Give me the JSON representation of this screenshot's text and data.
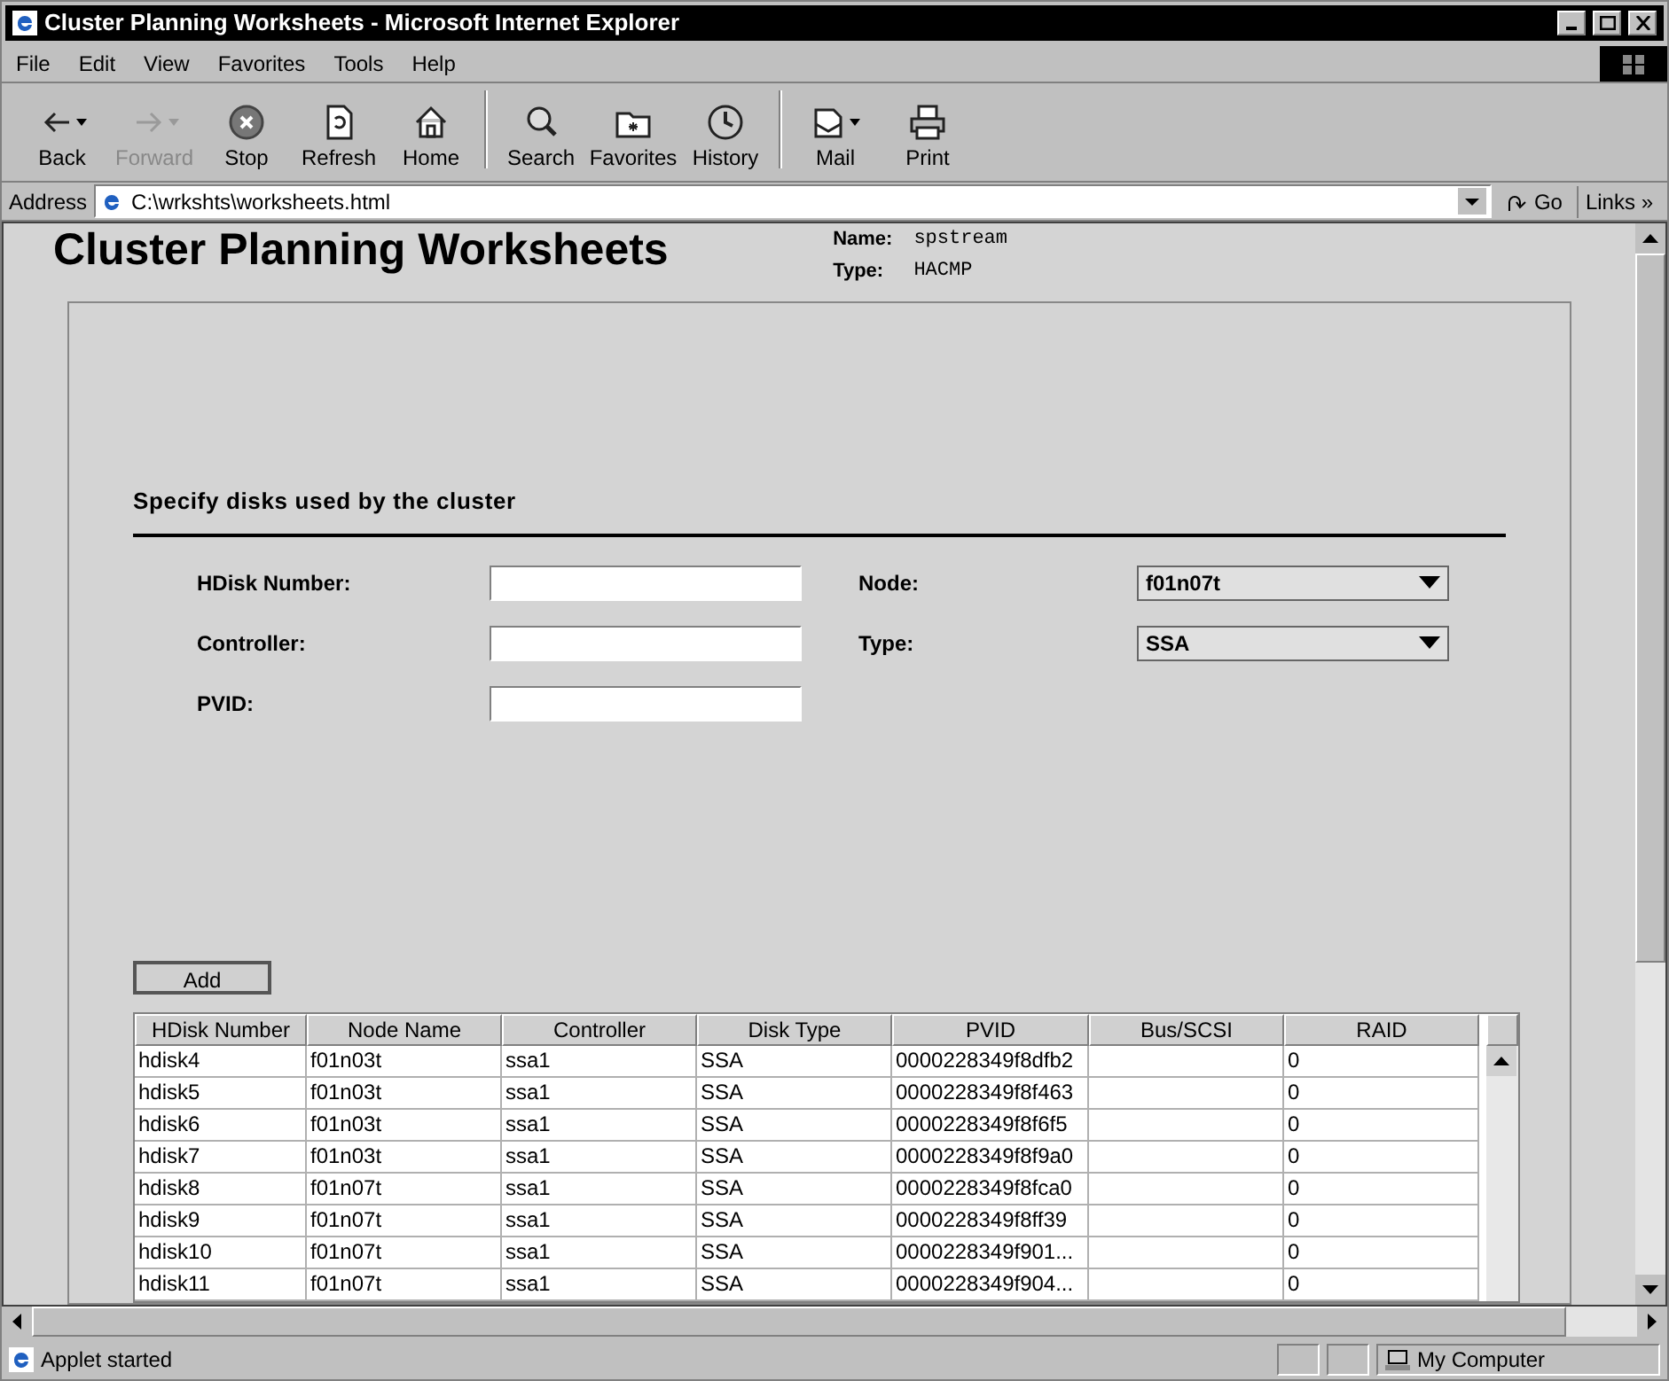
{
  "window": {
    "title": "Cluster Planning Worksheets - Microsoft Internet Explorer"
  },
  "menu": [
    "File",
    "Edit",
    "View",
    "Favorites",
    "Tools",
    "Help"
  ],
  "toolbar": [
    {
      "kind": "back",
      "label": "Back",
      "disabled": false,
      "dropdown": true
    },
    {
      "kind": "forward",
      "label": "Forward",
      "disabled": true,
      "dropdown": true
    },
    {
      "kind": "stop",
      "label": "Stop",
      "disabled": false,
      "dropdown": false
    },
    {
      "kind": "refresh",
      "label": "Refresh",
      "disabled": false,
      "dropdown": false
    },
    {
      "kind": "home",
      "label": "Home",
      "disabled": false,
      "dropdown": false
    },
    {
      "kind": "search",
      "label": "Search",
      "disabled": false,
      "dropdown": false
    },
    {
      "kind": "favorites",
      "label": "Favorites",
      "disabled": false,
      "dropdown": false
    },
    {
      "kind": "history",
      "label": "History",
      "disabled": false,
      "dropdown": false
    },
    {
      "kind": "mail",
      "label": "Mail",
      "disabled": false,
      "dropdown": true
    },
    {
      "kind": "print",
      "label": "Print",
      "disabled": false,
      "dropdown": false
    }
  ],
  "address": {
    "label": "Address",
    "value": "C:\\wrkshts\\worksheets.html",
    "go": "Go",
    "links": "Links »"
  },
  "page": {
    "title": "Cluster Planning Worksheets",
    "info": [
      {
        "label": "Name:",
        "value": "spstream"
      },
      {
        "label": "Type:",
        "value": "HACMP"
      }
    ],
    "section": "Specify disks used by the cluster",
    "fields": [
      {
        "label": "HDisk Number:"
      },
      {
        "label": "Controller:"
      },
      {
        "label": "PVID:"
      }
    ],
    "selects": [
      {
        "label": "Node:",
        "value": "f01n07t"
      },
      {
        "label": "Type:",
        "value": "SSA"
      }
    ],
    "add_button": "Add",
    "table": {
      "columns": [
        "HDisk Number",
        "Node Name",
        "Controller",
        "Disk Type",
        "PVID",
        "Bus/SCSI",
        "RAID"
      ],
      "rows": [
        [
          "hdisk4",
          "f01n03t",
          "ssa1",
          "SSA",
          "0000228349f8dfb2",
          "",
          "0"
        ],
        [
          "hdisk5",
          "f01n03t",
          "ssa1",
          "SSA",
          "0000228349f8f463",
          "",
          "0"
        ],
        [
          "hdisk6",
          "f01n03t",
          "ssa1",
          "SSA",
          "0000228349f8f6f5",
          "",
          "0"
        ],
        [
          "hdisk7",
          "f01n03t",
          "ssa1",
          "SSA",
          "0000228349f8f9a0",
          "",
          "0"
        ],
        [
          "hdisk8",
          "f01n07t",
          "ssa1",
          "SSA",
          "0000228349f8fca0",
          "",
          "0"
        ],
        [
          "hdisk9",
          "f01n07t",
          "ssa1",
          "SSA",
          "0000228349f8ff39",
          "",
          "0"
        ],
        [
          "hdisk10",
          "f01n07t",
          "ssa1",
          "SSA",
          "0000228349f901...",
          "",
          "0"
        ],
        [
          "hdisk11",
          "f01n07t",
          "ssa1",
          "SSA",
          "0000228349f904...",
          "",
          "0"
        ]
      ]
    }
  },
  "status_bar": {
    "text": "Applet started",
    "zone": "My Computer"
  }
}
